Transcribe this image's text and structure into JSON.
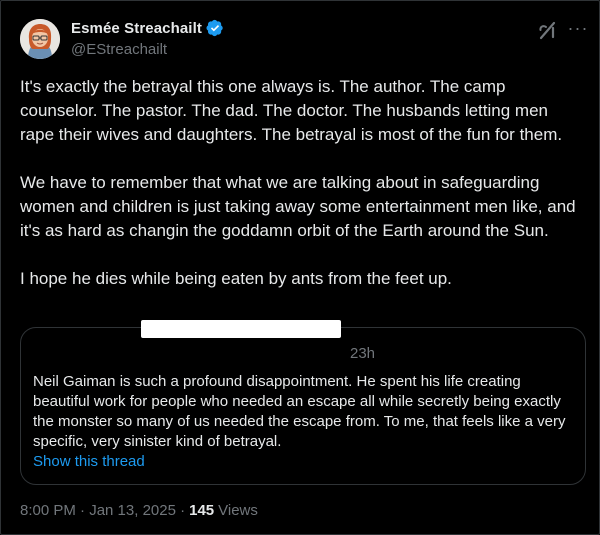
{
  "author": {
    "display_name": "Esmée Streachailt",
    "handle": "@EStreachailt",
    "verified": true
  },
  "tweet": {
    "paragraphs": [
      "It's exactly the betrayal this one always is. The author. The camp counselor. The pastor. The dad. The doctor. The husbands letting men rape their wives and daughters. The betrayal is most of the fun for them.",
      "We have to remember that what we are talking about in safeguarding women and children is just taking away some entertainment men like, and it's as hard as changin the goddamn orbit of the Earth around the Sun.",
      "I hope he dies while being eaten by ants from the feet up."
    ]
  },
  "quote": {
    "time": "23h",
    "text": "Neil Gaiman is such a profound disappointment. He spent his life creating beautiful work for people who needed an escape all while secretly being exactly the monster so many of us needed the escape from. To me, that feels like a very specific, very sinister kind of betrayal.",
    "show_thread_label": "Show this thread"
  },
  "meta": {
    "timestamp": "8:00 PM · Jan 13, 2025 ·",
    "views_count": "145",
    "views_label": "Views"
  },
  "icons": {
    "verified": "verified-badge-icon",
    "grok": "grok-icon",
    "more": "more-icon"
  },
  "colors": {
    "background": "#000000",
    "text": "#e7e9ea",
    "muted": "#71767b",
    "link": "#1d9bf0",
    "border": "#2f3336",
    "verified": "#1d9bf0"
  }
}
